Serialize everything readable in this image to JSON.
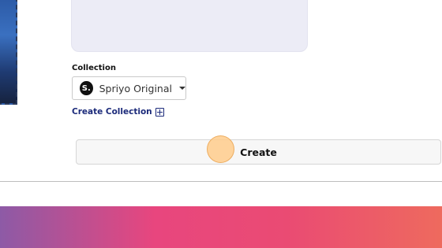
{
  "form": {
    "collection_label": "Collection",
    "collection_select": {
      "avatar_letter": "S.",
      "selected_value": "Spriyo Original"
    },
    "create_collection_link": "Create Collection",
    "create_button_label": "Create"
  },
  "colors": {
    "link": "#1b2a7a",
    "footer_gradient": [
      "#8d5aa6",
      "#e8467e",
      "#ea4b73",
      "#ee6a5e"
    ]
  },
  "icons": [
    "caret-down-icon",
    "plus-box-icon"
  ]
}
